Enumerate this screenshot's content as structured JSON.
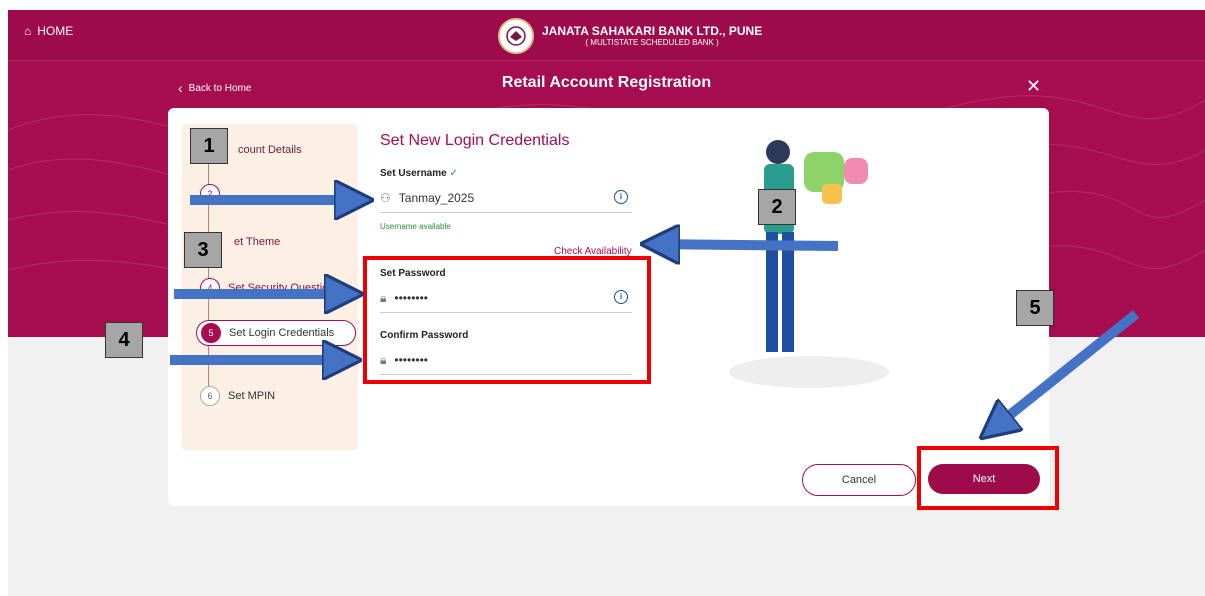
{
  "header": {
    "home_label": "HOME",
    "bank_name": "JANATA SAHAKARI BANK LTD., PUNE",
    "bank_sub": "( MULTISTATE SCHEDULED BANK )",
    "back_label": "Back to Home",
    "page_title": "Retail Account Registration"
  },
  "steps": [
    {
      "num": "1",
      "label": "count Details"
    },
    {
      "num": "2",
      "label": ""
    },
    {
      "num": "3",
      "label": "et Theme"
    },
    {
      "num": "4",
      "label": "Set Security Questions"
    },
    {
      "num": "5",
      "label": "Set Login Credentials"
    },
    {
      "num": "6",
      "label": "Set MPIN"
    }
  ],
  "form": {
    "title": "Set New Login Credentials",
    "username_label": "Set Username",
    "username_value": "Tanmay_2025",
    "username_status": "Username available",
    "check_availability": "Check Availability",
    "password_label": "Set Password",
    "password_value": "••••••••",
    "confirm_label": "Confirm Password",
    "confirm_value": "••••••••"
  },
  "buttons": {
    "cancel": "Cancel",
    "next": "Next"
  },
  "callouts": [
    "1",
    "2",
    "3",
    "4",
    "5"
  ],
  "colors": {
    "brand": "#a60d4e",
    "highlight": "#e00000",
    "arrow": "#4472c4"
  }
}
